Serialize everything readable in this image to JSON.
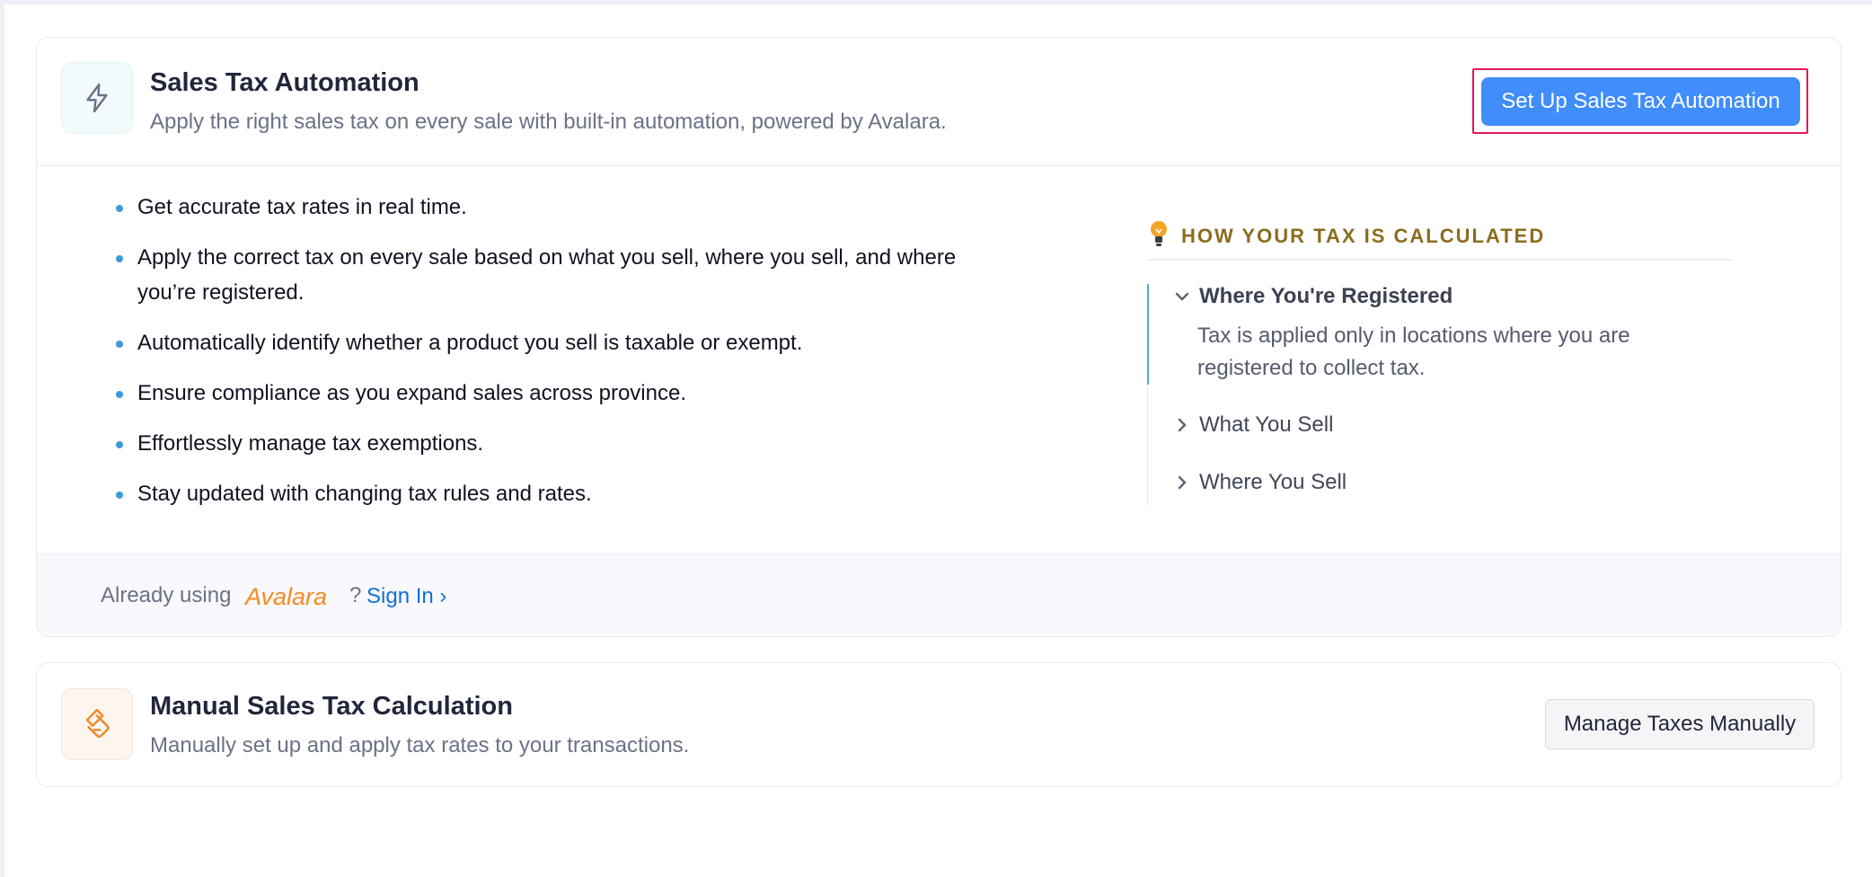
{
  "automation": {
    "icon": "lightning-bolt-icon",
    "title": "Sales Tax Automation",
    "description": "Apply the right sales tax on every sale with built-in automation, powered by Avalara.",
    "cta_label": "Set Up Sales Tax Automation",
    "benefits": [
      "Get accurate tax rates in real time.",
      "Apply the correct tax on every sale based on what you sell, where you sell, and where you’re registered.",
      "Automatically identify whether a product you sell is taxable or exempt.",
      "Ensure compliance as you expand sales across province.",
      "Effortlessly manage tax exemptions.",
      "Stay updated with changing tax rules and rates."
    ],
    "calculation": {
      "heading": "HOW YOUR TAX IS CALCULATED",
      "heading_icon": "lightbulb-icon",
      "items": [
        {
          "label": "Where You're Registered",
          "expanded": true,
          "body": "Tax is applied only in locations where you are registered to collect tax."
        },
        {
          "label": "What You Sell",
          "expanded": false
        },
        {
          "label": "Where You Sell",
          "expanded": false
        }
      ]
    },
    "footer": {
      "prefix": "Already using",
      "logo_text": "Avalara",
      "suffix": "?",
      "sign_in_label": "Sign In ›"
    }
  },
  "manual": {
    "icon": "receipt-pencil-icon",
    "title": "Manual Sales Tax Calculation",
    "description": "Manually set up and apply tax rates to your transactions.",
    "cta_label": "Manage Taxes Manually"
  },
  "colors": {
    "primary_button": "#408dfb",
    "focus_outline": "#e5155a",
    "heading_gold": "#8a6d1e",
    "link": "#1070d8",
    "avalara_orange": "#f58a1f"
  }
}
